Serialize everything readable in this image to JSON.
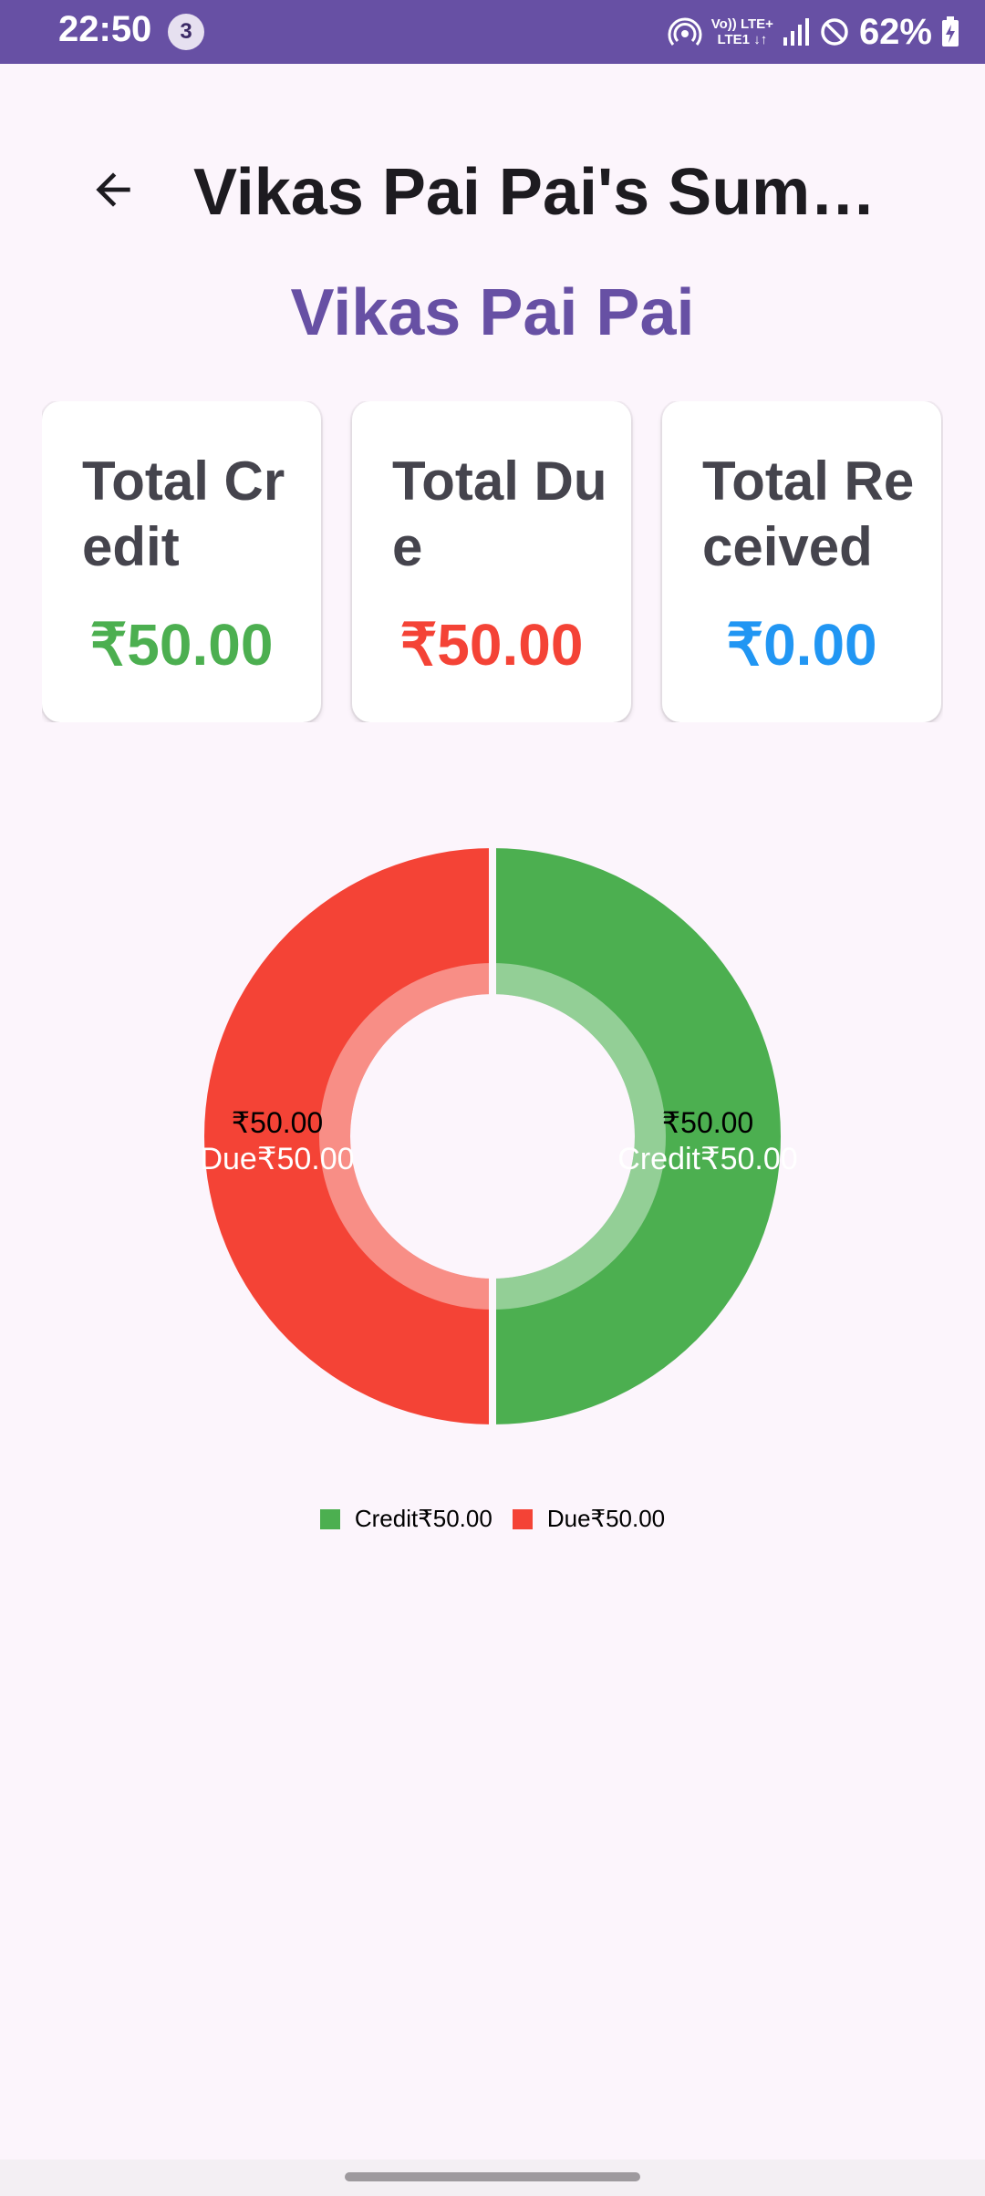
{
  "status_bar": {
    "time": "22:50",
    "notification_count": "3",
    "network_line1": "Vo)) LTE+",
    "network_line2": "LTE1 ↓↑",
    "battery_percent": "62%"
  },
  "app_bar": {
    "back_icon": "arrow-left-icon",
    "title": "Vikas Pai Pai's Summary"
  },
  "person_name": "Vikas Pai Pai",
  "cards": [
    {
      "label": "Total Credit",
      "value": "₹50.00",
      "color": "#4caf50"
    },
    {
      "label": "Total Due",
      "value": "₹50.00",
      "color": "#f44336"
    },
    {
      "label": "Total Received",
      "value": "₹0.00",
      "color": "#2196f3"
    }
  ],
  "chart_data": {
    "type": "pie",
    "categories": [
      "Credit",
      "Due"
    ],
    "values": [
      50,
      50
    ],
    "colors": [
      "#4caf50",
      "#f44336"
    ],
    "slice_labels": [
      {
        "value": "₹50.00",
        "label": "Credit₹50.00"
      },
      {
        "value": "₹50.00",
        "label": "Due₹50.00"
      }
    ],
    "legend_position": "bottom"
  },
  "legend": [
    {
      "label": "Credit₹50.00",
      "color": "#4caf50"
    },
    {
      "label": "Due₹50.00",
      "color": "#f44336"
    }
  ]
}
